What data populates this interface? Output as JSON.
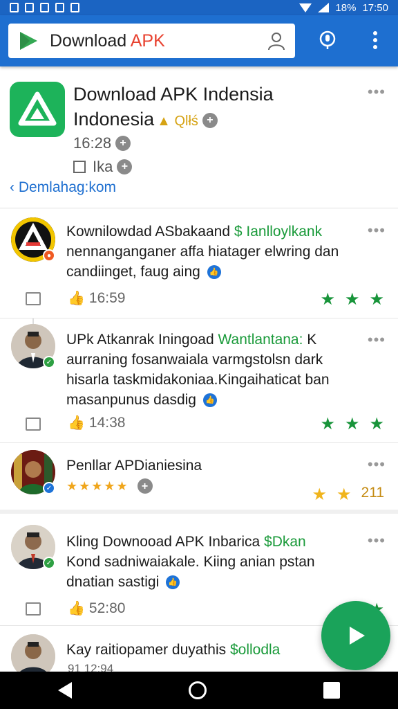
{
  "status_bar": {
    "battery": "18%",
    "time": "17:50"
  },
  "search": {
    "brand": "Download ",
    "accent": "APK"
  },
  "colors": {
    "app_bar": "#1e6fd0",
    "status_bar": "#1b64c2",
    "accent_green": "#1aa35a",
    "star_green": "#18943a",
    "star_gold": "#f0b41c"
  },
  "app": {
    "title_line1": "Download APK Indensia",
    "title_line2": "Indonesia",
    "chip": "Qlłś",
    "time": "16:28",
    "lang": "Ika",
    "back_link": "Demlahag:kom"
  },
  "reviews": [
    {
      "name": "Kownilowdad ASbakaand",
      "price": "$ Ianlloylkank",
      "body": "nennanganganer affa hiatager elwring dan candiinget, faug aing",
      "time": "16:59",
      "rating": 3
    },
    {
      "name": "UPk Atkanrak Iningoad",
      "price": "Wantlantana:",
      "suffix": "K",
      "body": "aurraning fosanwaiala varmgstolsn dark hisarla taskmidakoniaa.Kingaihaticat ban masanpunus dasdig",
      "time": "14:38",
      "rating": 3
    },
    {
      "name": "Penllar APDianiesina",
      "rating_text": "211",
      "rating": 2
    },
    {
      "name": "Kling Downooad  APK Inbarica",
      "price": "$Dkan",
      "body": "Kond sadniwaiakale. Kiing anian pstan dnatian sastigi",
      "time": "52:80",
      "rating": 2
    },
    {
      "name": "Kay raitiopamer duyathis",
      "price": "$ollodla",
      "time": "91 12:94"
    }
  ]
}
